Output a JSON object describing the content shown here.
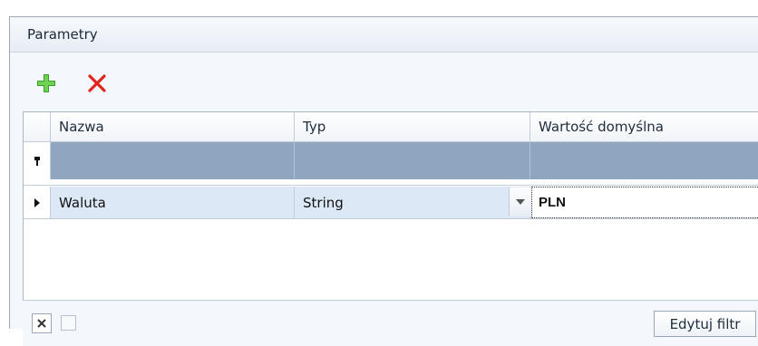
{
  "panel": {
    "title": "Parametry"
  },
  "toolbar": {
    "add_icon": "plus-icon",
    "delete_icon": "delete-x-icon"
  },
  "grid": {
    "columns": [
      "Nazwa",
      "Typ",
      "Wartość domyślna"
    ],
    "filter_row_icon": "filter-pin-icon",
    "rows": [
      {
        "indicator_icon": "row-pointer-icon",
        "nazwa": "Waluta",
        "typ": "String",
        "wartosc": "PLN"
      }
    ]
  },
  "footer": {
    "edit_filter_label": "Edytuj filtr",
    "clear_filter_icon": "clear-filter-x-icon"
  },
  "colors": {
    "accent_add": "#3aa12a",
    "accent_delete": "#e0261b",
    "filter_row": "#8fa6c1",
    "selected_row": "#dde8f7"
  }
}
